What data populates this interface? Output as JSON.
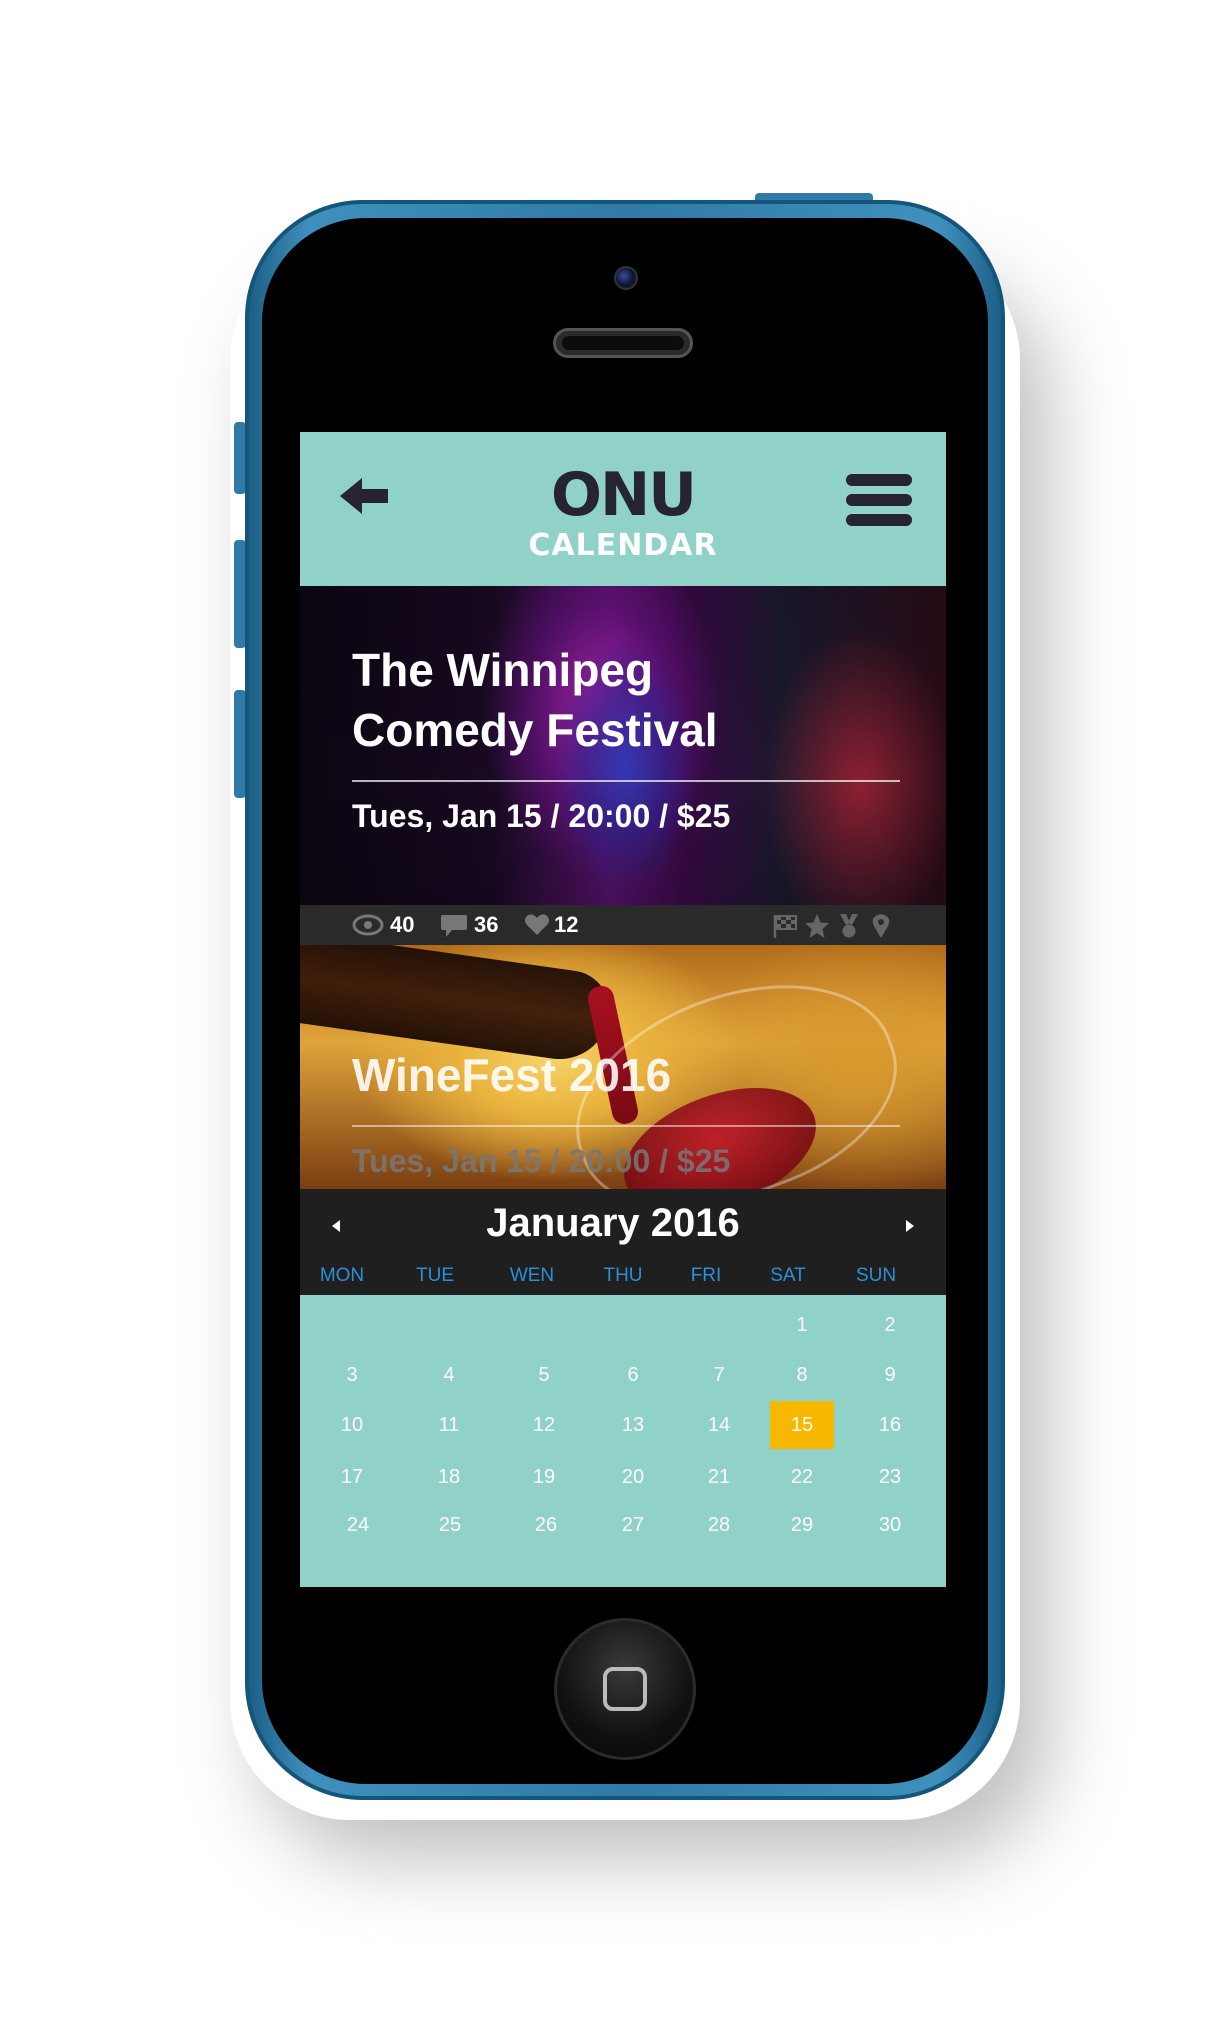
{
  "header": {
    "logo": "ONU",
    "subtitle": "CALENDAR",
    "back_icon": "arrow-left-icon",
    "menu_icon": "hamburger-menu-icon"
  },
  "events": [
    {
      "title_line1": "The Winnipeg",
      "title_line2": "Comedy Festival",
      "meta": "Tues, Jan 15 / 20:00 / $25",
      "stats": {
        "views": "40",
        "comments": "36",
        "likes": "12"
      }
    },
    {
      "title": "WineFest 2016",
      "meta": "Tues, Jan 15 / 20:00 / $25"
    }
  ],
  "calendar": {
    "month_label": "January 2016",
    "weekdays": [
      "MON",
      "TUE",
      "WEN",
      "THU",
      "FRI",
      "SAT",
      "SUN"
    ],
    "selected_day": "15",
    "rows": [
      [
        "",
        "",
        "",
        "",
        "",
        "1",
        "2"
      ],
      [
        "3",
        "4",
        "5",
        "6",
        "7",
        "8",
        "9"
      ],
      [
        "10",
        "11",
        "12",
        "13",
        "14",
        "15",
        "16"
      ],
      [
        "17",
        "18",
        "19",
        "20",
        "21",
        "22",
        "23"
      ],
      [
        "24",
        "25",
        "26",
        "27",
        "28",
        "29",
        "30"
      ]
    ]
  },
  "colors": {
    "header_bg": "#90d2c8",
    "logo": "#262431",
    "weekday": "#2b8fd6",
    "selected_day": "#f9b800",
    "phone_body": "#2f7aa6"
  }
}
